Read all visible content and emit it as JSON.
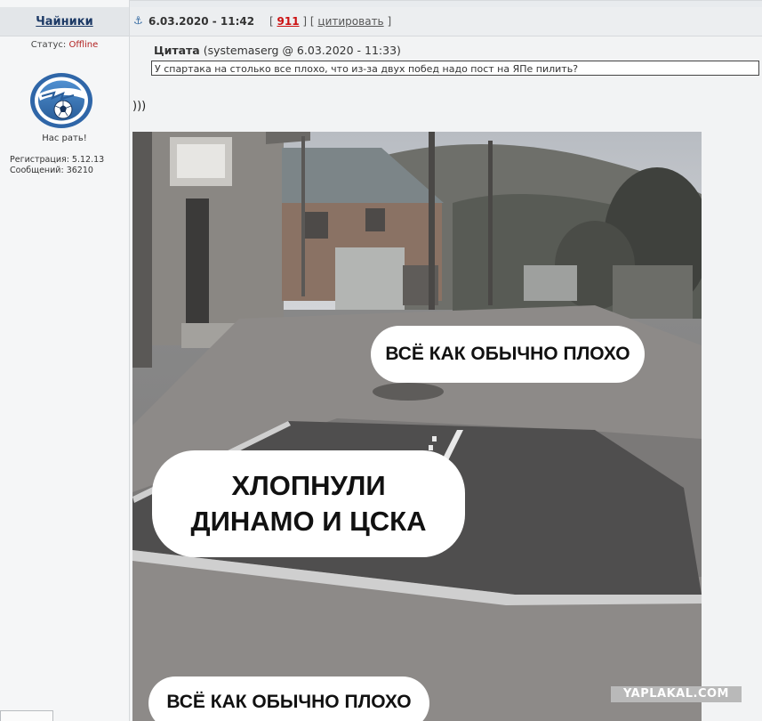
{
  "user": {
    "name": "Чайники",
    "status_label": "Статус:",
    "status_value": "Offline",
    "avatar_icon": "zenit-club-logo",
    "tagline": "Нас рать!",
    "registration": "Регистрация: 5.12.13",
    "messages": "Сообщений: 36210"
  },
  "post": {
    "anchor_icon": "anchor-icon",
    "date": "6.03.2020 - 11:42",
    "bracket_open": "[",
    "rating": "911",
    "bracket_mid": "] [",
    "quote_link": "цитировать",
    "bracket_close": "]",
    "quote_label": "Цитата",
    "quote_source": "(systemaserg @ 6.03.2020 - 11:33)",
    "quote_text": "У спартака на столько все плохо, что из-за двух побед надо пост на ЯПе пилить?",
    "text": ")))"
  },
  "meme": {
    "caption_top": "ВСЁ КАК ОБЫЧНО ПЛОХО",
    "caption_middle_line1": "ХЛОПНУЛИ",
    "caption_middle_line2": "ДИНАМО И ЦСКА",
    "caption_bottom": "ВСЁ КАК ОБЫЧНО ПЛОХО"
  },
  "watermark": "YAPLAKAL.COM",
  "colors": {
    "username": "#1d3a66",
    "offline": "#b22222",
    "rating": "#cc1111",
    "watermark_bg": "#b9b9b9"
  }
}
